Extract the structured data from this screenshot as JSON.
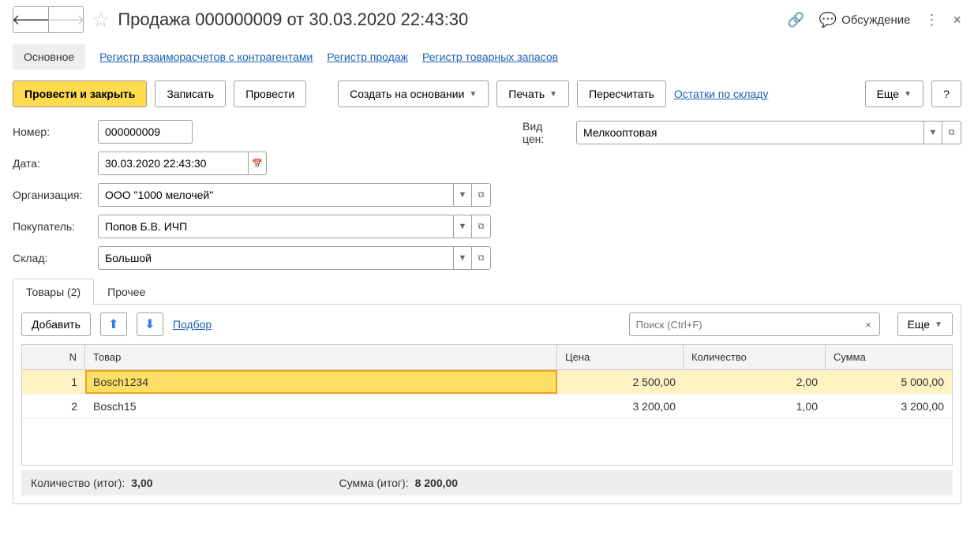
{
  "header": {
    "title": "Продажа 000000009 от 30.03.2020 22:43:30",
    "discuss": "Обсуждение"
  },
  "nav": {
    "main": "Основное",
    "reg1": "Регистр взаиморасчетов с контрагентами",
    "reg2": "Регистр продаж",
    "reg3": "Регистр товарных запасов"
  },
  "toolbar": {
    "post_close": "Провести и закрыть",
    "save": "Записать",
    "post": "Провести",
    "create_based": "Создать на основании",
    "print": "Печать",
    "recalc": "Пересчитать",
    "stock_link": "Остатки по складу",
    "more": "Еще",
    "help": "?"
  },
  "form": {
    "number_label": "Номер:",
    "number": "000000009",
    "date_label": "Дата:",
    "date": "30.03.2020 22:43:30",
    "org_label": "Организация:",
    "org": "ООО \"1000 мелочей\"",
    "buyer_label": "Покупатель:",
    "buyer": "Попов Б.В. ИЧП",
    "warehouse_label": "Склад:",
    "warehouse": "Большой",
    "pricetype_label": "Вид цен:",
    "pricetype": "Мелкооптовая"
  },
  "tabs": {
    "goods": "Товары (2)",
    "other": "Прочее"
  },
  "panel": {
    "add": "Добавить",
    "pick": "Подбор",
    "search_placeholder": "Поиск (Ctrl+F)",
    "more": "Еще"
  },
  "grid": {
    "cols": {
      "n": "N",
      "name": "Товар",
      "price": "Цена",
      "qty": "Количество",
      "sum": "Сумма"
    },
    "rows": [
      {
        "n": "1",
        "name": "Bosch1234",
        "price": "2 500,00",
        "qty": "2,00",
        "sum": "5 000,00"
      },
      {
        "n": "2",
        "name": "Bosch15",
        "price": "3 200,00",
        "qty": "1,00",
        "sum": "3 200,00"
      }
    ]
  },
  "totals": {
    "qty_label": "Количество (итог):",
    "qty": "3,00",
    "sum_label": "Сумма (итог):",
    "sum": "8 200,00"
  }
}
